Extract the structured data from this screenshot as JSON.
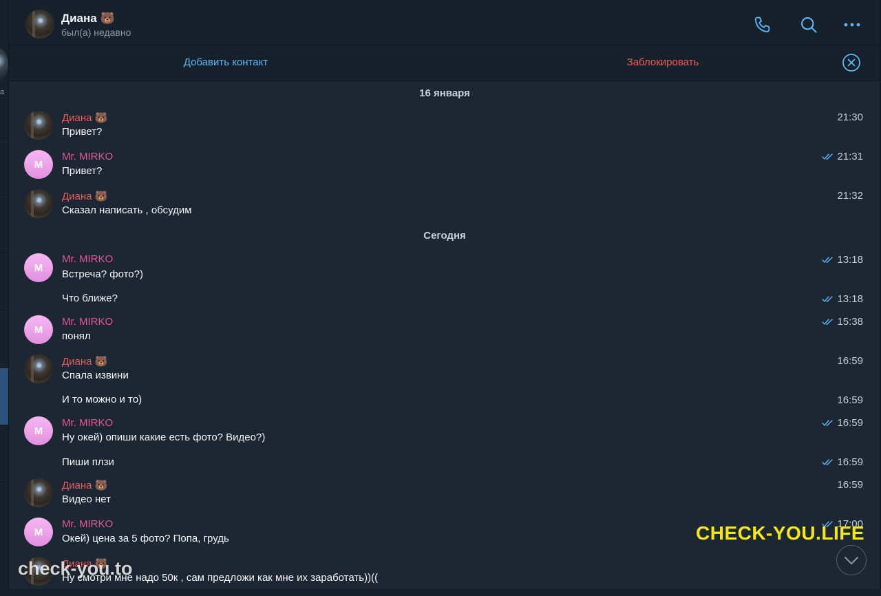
{
  "header": {
    "name": "Диана 🐻",
    "status": "был(а) недавно",
    "icons": [
      "phone-icon",
      "search-icon",
      "more-icon"
    ]
  },
  "action_bar": {
    "add_contact": "Добавить контакт",
    "block": "Заблокировать"
  },
  "left_pane": {
    "letter": "а"
  },
  "avatar_letter": "M",
  "colors": {
    "accent": "#5eb5f7",
    "danger": "#ec5b5b",
    "sender_diana": "#e75e5e",
    "sender_mirko": "#e2569d",
    "background": "#1d2733",
    "panel": "#17212b"
  },
  "dates": [
    "16 января",
    "Сегодня"
  ],
  "messages": [
    {
      "sender": "Диана 🐻",
      "text": "Привет?",
      "time": "21:30",
      "read": false
    },
    {
      "sender": "Mr. MIRKO",
      "text": "Привет?",
      "time": "21:31",
      "read": true
    },
    {
      "sender": "Диана 🐻",
      "text": "Сказал написать , обсудим",
      "time": "21:32",
      "read": false
    },
    {
      "sender": "Mr. MIRKO",
      "text": "Встреча? фото?)",
      "time": "13:18",
      "read": true
    },
    {
      "sender": "",
      "text": "Что ближе?",
      "time": "13:18",
      "read": true
    },
    {
      "sender": "Mr. MIRKO",
      "text": "понял",
      "time": "15:38",
      "read": true
    },
    {
      "sender": "Диана 🐻",
      "text": "Спала извини",
      "time": "16:59",
      "read": false
    },
    {
      "sender": "",
      "text": "И то можно и то)",
      "time": "16:59",
      "read": false
    },
    {
      "sender": "Mr. MIRKO",
      "text": "Ну окей) опиши какие есть фото? Видео?)",
      "time": "16:59",
      "read": true
    },
    {
      "sender": "",
      "text": "Пиши плзи",
      "time": "16:59",
      "read": true
    },
    {
      "sender": "Диана 🐻",
      "text": "Видео нет",
      "time": "16:59",
      "read": false
    },
    {
      "sender": "Mr. MIRKO",
      "text": "Окей) цена за 5 фото? Попа, грудь",
      "time": "17:00",
      "read": true
    },
    {
      "sender": "Диана 🐻",
      "text": "Ну смотри мне надо 50к , сам предложи как мне их заработать))((",
      "time": "",
      "read": false
    }
  ],
  "watermarks": {
    "yellow": "CHECK-YOU.LIFE",
    "white": "check-you.to"
  }
}
